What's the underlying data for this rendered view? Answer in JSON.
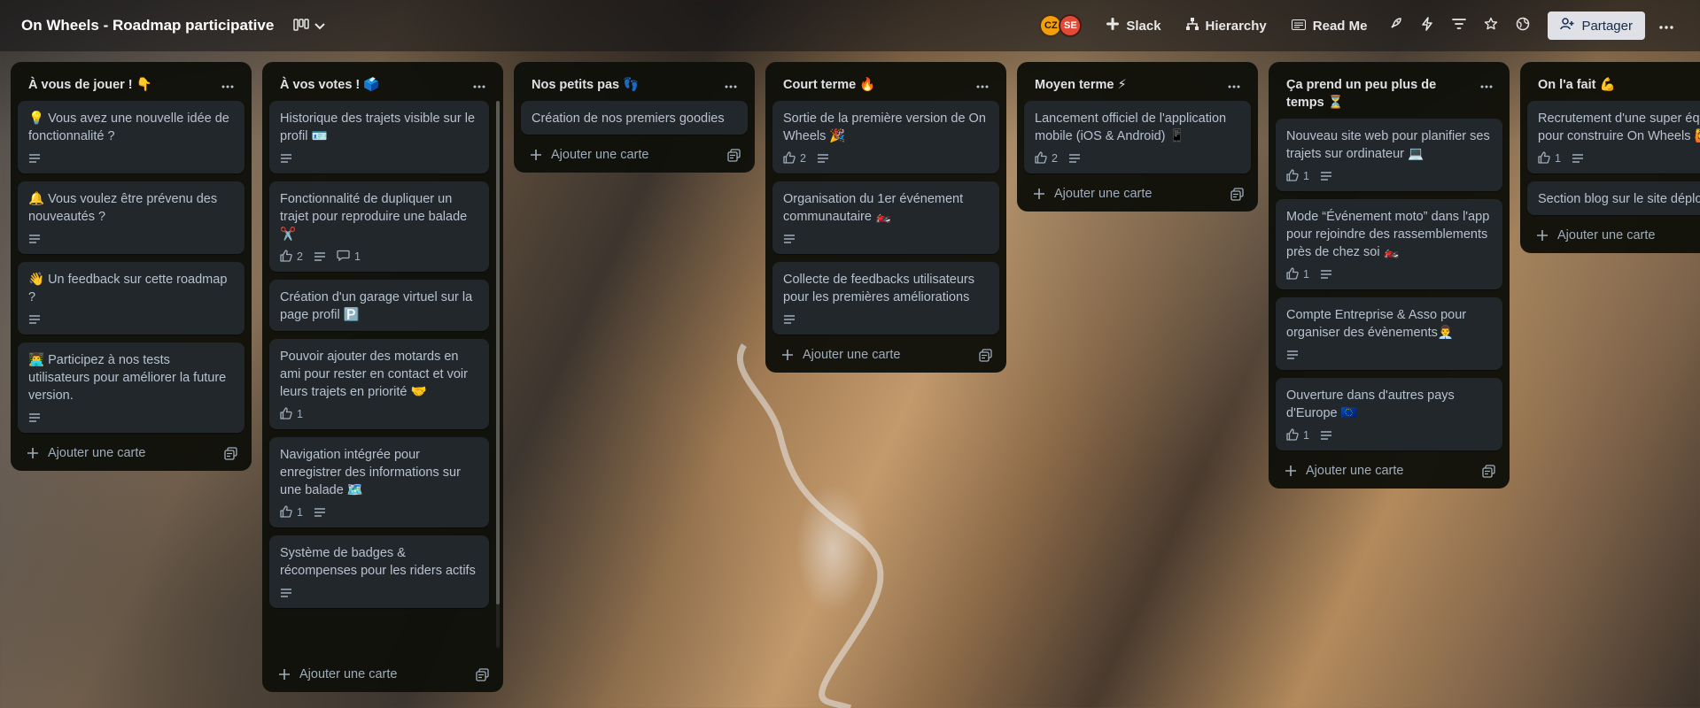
{
  "header": {
    "title": "On Wheels - Roadmap participative",
    "view_icon": "board-view-icon",
    "avatars": [
      {
        "initials": "CZ",
        "color": "#f59e0b"
      },
      {
        "initials": "SE",
        "color": "#e34935"
      }
    ],
    "buttons": [
      {
        "label": "Slack",
        "icon": "slack-icon"
      },
      {
        "label": "Hierarchy",
        "icon": "hierarchy-icon"
      },
      {
        "label": "Read Me",
        "icon": "readme-icon"
      }
    ],
    "share_label": "Partager"
  },
  "add_card_label": "Ajouter une carte",
  "lists": [
    {
      "title": "À vous de jouer ! 👇",
      "cards": [
        {
          "title": "💡 Vous avez une nouvelle idée de fonctionnalité ?",
          "likes": null,
          "desc": true,
          "comments": null
        },
        {
          "title": "🔔 Vous voulez être prévenu des nouveautés ?",
          "likes": null,
          "desc": true,
          "comments": null
        },
        {
          "title": "👋 Un feedback sur cette roadmap ?",
          "likes": null,
          "desc": true,
          "comments": null
        },
        {
          "title": "👨‍💻 Participez à nos tests utilisateurs pour améliorer la future version.",
          "likes": null,
          "desc": true,
          "comments": null
        }
      ]
    },
    {
      "title": "À vos votes ! 🗳️",
      "scroll": true,
      "cards": [
        {
          "title": "Historique des trajets visible sur le profil 🪪",
          "likes": null,
          "desc": true,
          "comments": null
        },
        {
          "title": "Fonctionnalité de dupliquer un trajet pour reproduire une balade ✂️",
          "likes": "2",
          "desc": true,
          "comments": "1"
        },
        {
          "title": "Création d'un garage virtuel sur la page profil 🅿️",
          "likes": null,
          "desc": false,
          "comments": null
        },
        {
          "title": "Pouvoir ajouter des motards en ami pour rester en contact et voir leurs trajets en priorité 🤝",
          "likes": "1",
          "desc": false,
          "comments": null
        },
        {
          "title": "Navigation intégrée pour enregistrer des informations sur une balade 🗺️",
          "likes": "1",
          "desc": true,
          "comments": null
        },
        {
          "title": "Système de badges & récompenses pour les riders actifs",
          "likes": null,
          "desc": true,
          "comments": null
        }
      ]
    },
    {
      "title": "Nos petits pas 👣",
      "cards": [
        {
          "title": "Création de nos premiers goodies",
          "likes": null,
          "desc": false,
          "comments": null
        }
      ]
    },
    {
      "title": "Court terme 🔥",
      "cards": [
        {
          "title": "Sortie de la première version de On Wheels 🎉",
          "likes": "2",
          "desc": true,
          "comments": null
        },
        {
          "title": "Organisation du 1er événement communautaire 🏍️",
          "likes": null,
          "desc": true,
          "comments": null
        },
        {
          "title": "Collecte de feedbacks utilisateurs pour les premières améliorations",
          "likes": null,
          "desc": true,
          "comments": null
        }
      ]
    },
    {
      "title": "Moyen terme ⚡",
      "cards": [
        {
          "title": "Lancement officiel de l'application mobile (iOS & Android) 📱",
          "likes": "2",
          "desc": true,
          "comments": null
        }
      ]
    },
    {
      "title": "Ça prend un peu plus de temps ⏳",
      "cards": [
        {
          "title": "Nouveau site web pour planifier ses trajets sur ordinateur 💻",
          "likes": "1",
          "desc": true,
          "comments": null
        },
        {
          "title": "Mode “Événement moto” dans l'app pour rejoindre des rassemblements près de chez soi 🏍️",
          "likes": "1",
          "desc": true,
          "comments": null
        },
        {
          "title": "Compte Entreprise & Asso pour organiser des évènements👨‍💼",
          "likes": null,
          "desc": true,
          "comments": null
        },
        {
          "title": "Ouverture dans d'autres pays d'Europe 🇪🇺",
          "likes": "1",
          "desc": true,
          "comments": null
        }
      ]
    },
    {
      "title": "On l'a fait 💪",
      "cards": [
        {
          "title": "Recrutement d'une super équipe pour construire On Wheels 🙋",
          "likes": "1",
          "desc": true,
          "comments": null
        },
        {
          "title": "Section blog sur le site déployée",
          "likes": null,
          "desc": false,
          "comments": null
        }
      ]
    }
  ]
}
